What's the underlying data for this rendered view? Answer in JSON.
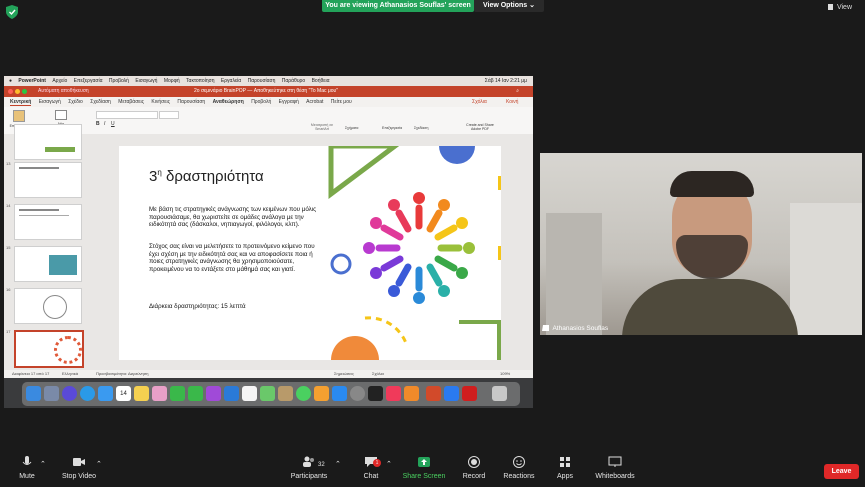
{
  "zoom": {
    "banner": "You are viewing Athanasios Souflas' screen",
    "view_options": "View Options",
    "view": "View",
    "participant_name": "Athanasios Souflas",
    "participants_count": "32",
    "chat_badge": "1",
    "toolbar": {
      "mute": "Mute",
      "stop_video": "Stop Video",
      "participants": "Participants",
      "chat": "Chat",
      "share_screen": "Share Screen",
      "record": "Record",
      "reactions": "Reactions",
      "apps": "Apps",
      "whiteboards": "Whiteboards",
      "leave": "Leave"
    }
  },
  "mac": {
    "menu": [
      "PowerPoint",
      "Αρχείο",
      "Επεξεργασία",
      "Προβολή",
      "Εισαγωγή",
      "Μορφή",
      "Τακτοποίηση",
      "Εργαλεία",
      "Παρουσίαση",
      "Παράθυρο",
      "Βοήθεια"
    ],
    "clock": "Σάβ 14 Ιαν 2:21 μμ"
  },
  "ppt": {
    "autosave": "Αυτόματη αποθήκευση",
    "title": "2ο σεμινάριο BrainPOP — Αποθηκεύτηκε στη θέση \"Το Mac μου\"",
    "tabs": [
      "Κεντρική",
      "Εισαγωγή",
      "Σχέδιο",
      "Σχεδίαση",
      "Μεταβάσεις",
      "Κινήσεις",
      "Παρουσίαση",
      "Αναθεώρηση",
      "Προβολή",
      "Εγγραφή",
      "Acrobat",
      "Πείτε μου"
    ],
    "comments": "Σχόλια",
    "share": "Κοινή χρήση",
    "ribbon": {
      "paste": "Επικόλληση",
      "new_slide": "Νέα διαφάνεια",
      "convert": "Μετατροπή σε SmartArt",
      "shapes": "Σχήματα",
      "editing": "Επεξεργασία",
      "design": "Σχεδίαση",
      "create_pdf": "Create and Share Adobe PDF"
    },
    "thumb_numbers": [
      "13",
      "14",
      "15",
      "16",
      "17"
    ],
    "slide": {
      "title_main": "3",
      "title_sup": "η",
      "title_rest": " δραστηριότητα",
      "p1": "Με βάση τις στρατηγικές ανάγνωσης των κειμένων που μόλις παρουσιάσαμε, θα χωριστείτε σε ομάδες ανάλογα με την ειδικότητά σας (δάσκαλοι, νηπιαγωγοί, φιλόλογοι, κλπ).",
      "p2": "Στόχος σας είναι να μελετήσετε το προτεινόμενο κείμενο που έχει σχέση με την ειδικότητά σας και να αποφασίσετε ποια ή ποιες στρατηγικές ανάγνωσης θα χρησιμοποιούσατε, προκειμένου να το εντάξετε στο μάθημά σας και γιατί.",
      "p3": "Διάρκεια δραστηριότητας: 15 λεπτά"
    },
    "status": {
      "slide_of": "Διαφάνεια 17 από 17",
      "language": "Ελληνικά",
      "accessibility": "Προσβασιμότητα: Διερεύνηση",
      "notes": "Σημειώσεις",
      "comments": "Σχόλια",
      "zoom": "109%"
    }
  },
  "dock": {
    "calendar_day": "14"
  }
}
